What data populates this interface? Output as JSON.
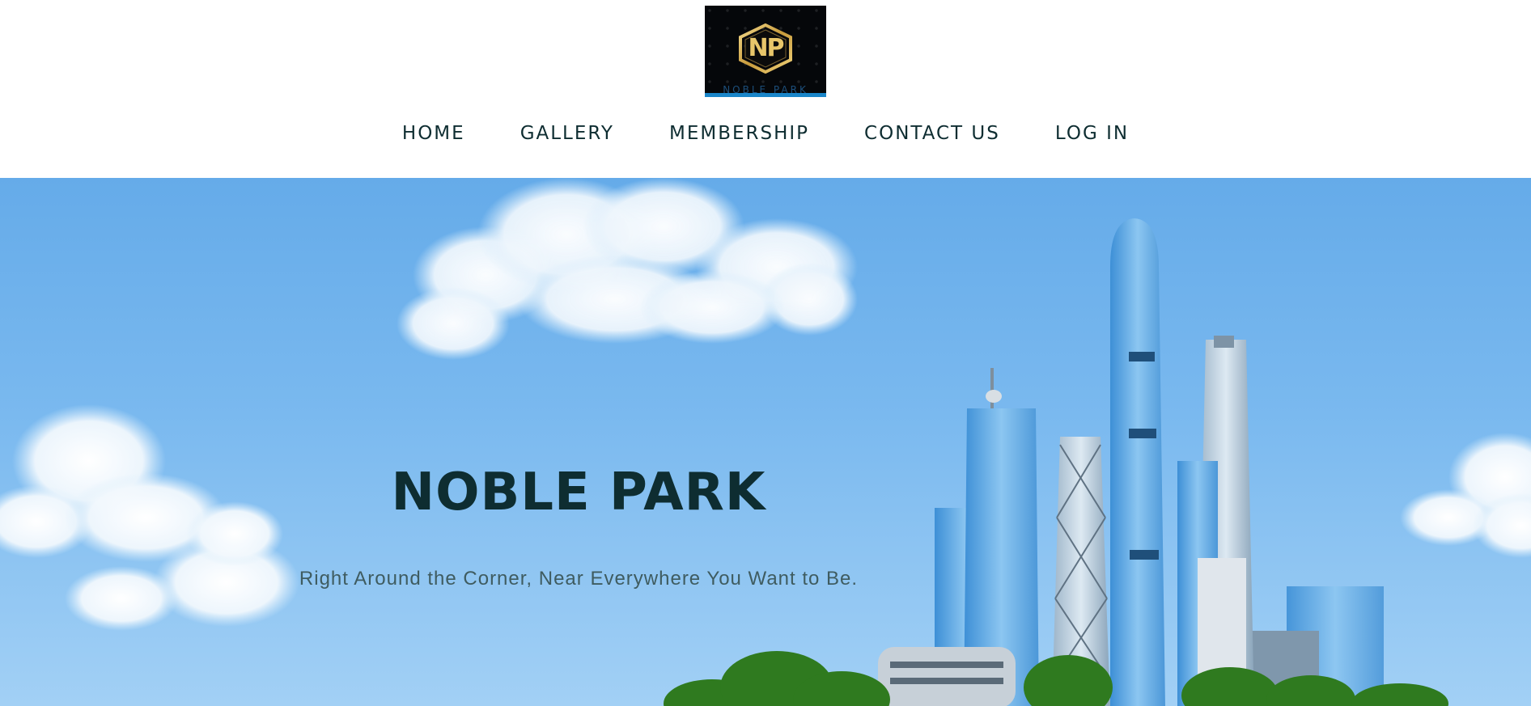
{
  "brand": {
    "logo_initials": "NP",
    "logo_wordmark": "NOBLE PARK",
    "logo_bg": "#05070a",
    "logo_accent": "#1a86c9",
    "logo_gold": "#d4a843"
  },
  "nav": {
    "items": [
      {
        "label": "HOME"
      },
      {
        "label": "GALLERY"
      },
      {
        "label": "MEMBERSHIP"
      },
      {
        "label": "CONTACT US"
      },
      {
        "label": "LOG IN"
      }
    ],
    "text_color": "#0e2d31"
  },
  "hero": {
    "title": "NOBLE PARK",
    "subtitle": "Right Around the Corner, Near Everywhere You Want to Be.",
    "sky_color": "#6fb2ec"
  }
}
